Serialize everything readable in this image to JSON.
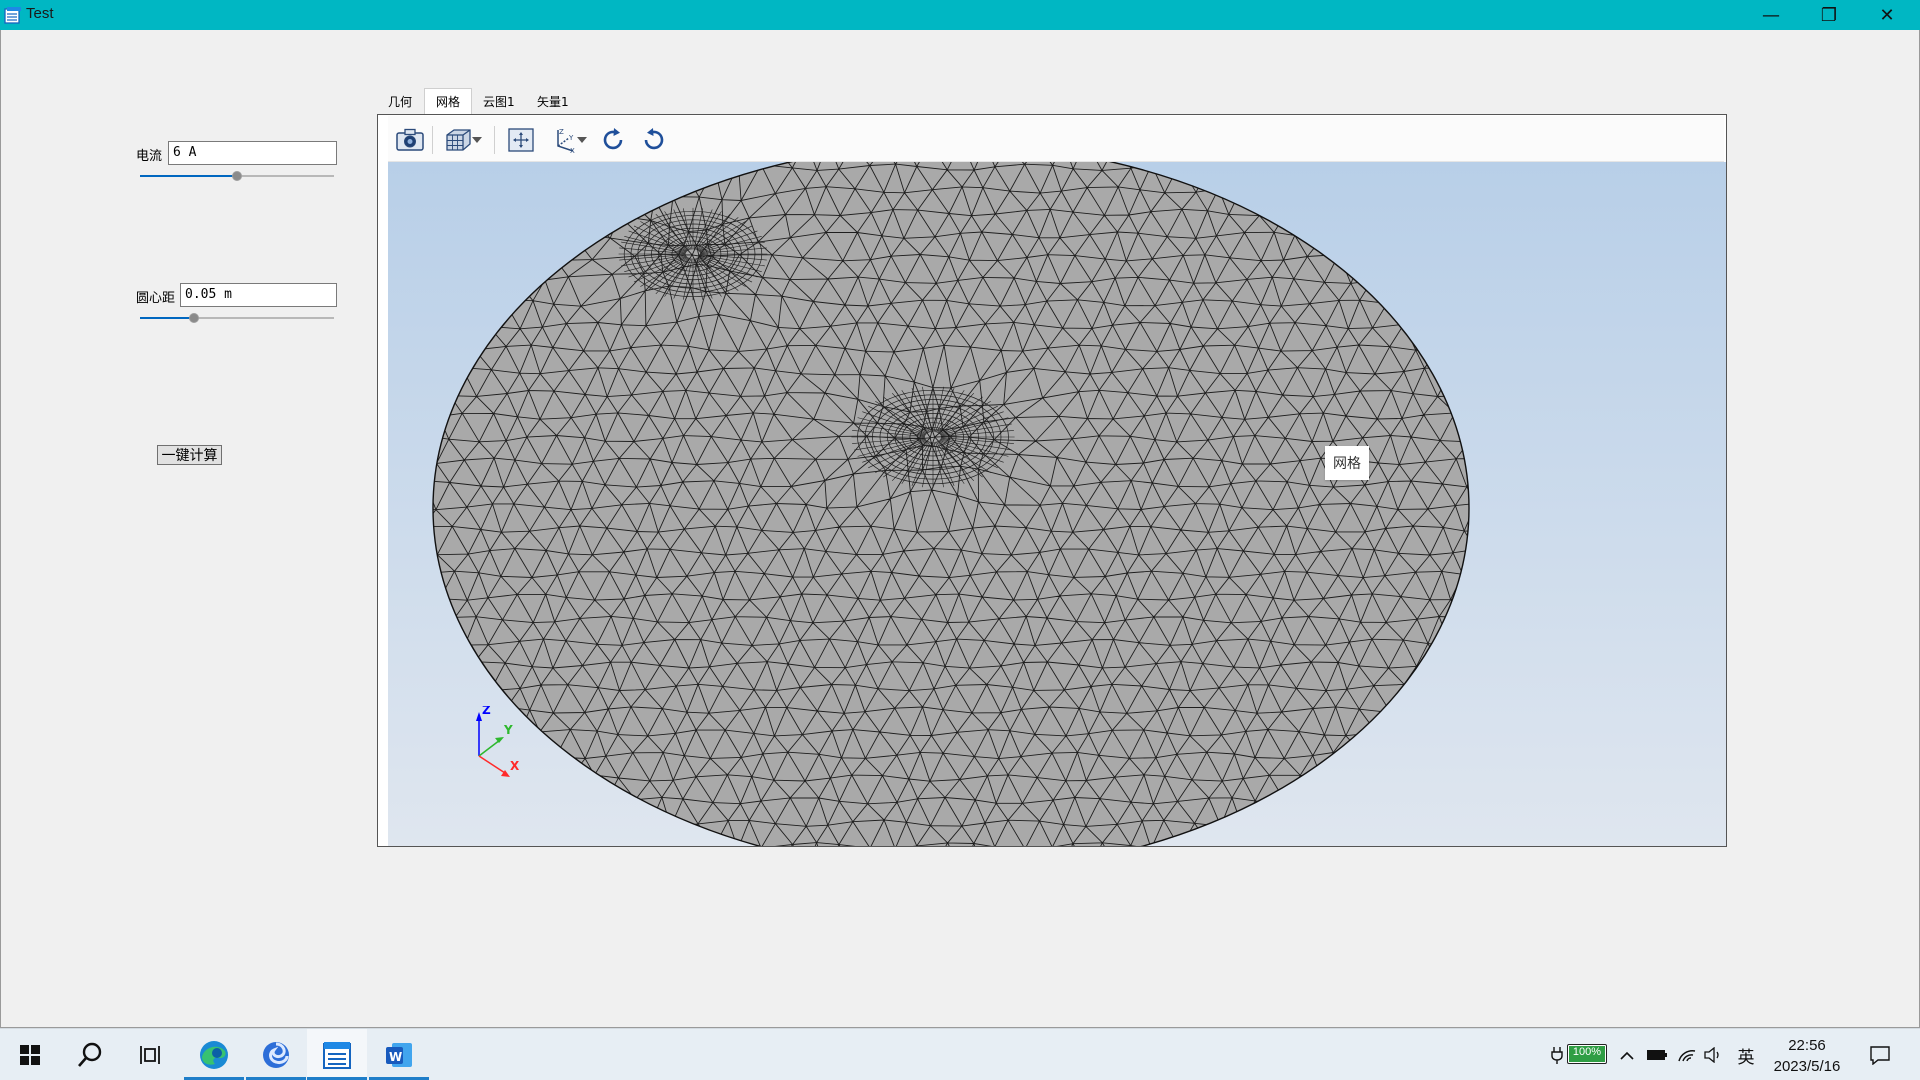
{
  "window": {
    "title": "Test",
    "minimize_glyph": "—",
    "restore_glyph": "❐",
    "close_glyph": "✕"
  },
  "params": {
    "current": {
      "label": "电流",
      "value": "6 A",
      "slider_fraction": 0.5
    },
    "center_distance": {
      "label": "圆心距",
      "value": "0.05 m",
      "slider_fraction": 0.28
    }
  },
  "calc_button": "一键计算",
  "tabs": [
    {
      "label": "几何",
      "active": false
    },
    {
      "label": "网格",
      "active": true
    },
    {
      "label": "云图1",
      "active": false
    },
    {
      "label": "矢量1",
      "active": false
    }
  ],
  "viewer": {
    "tooltip": "网格",
    "toolbar_icons": [
      "camera-icon",
      "cube-display-icon",
      "fit-view-icon",
      "axes-view-icon",
      "rotate-cw-icon",
      "rotate-ccw-icon"
    ],
    "axis_labels": {
      "x": "X",
      "y": "Y",
      "z": "Z"
    },
    "mesh_color": "#a9a9a9",
    "background_top": "#b8cfe8",
    "background_bottom": "#dfe6ef"
  },
  "taskbar": {
    "apps": [
      "windows-start-icon",
      "search-icon",
      "task-view-icon",
      "edge-icon",
      "app-swirl-icon",
      "test-app-icon",
      "word-icon"
    ],
    "battery": "100%",
    "ime": "英",
    "time": "22:56",
    "date": "2023/5/16"
  }
}
